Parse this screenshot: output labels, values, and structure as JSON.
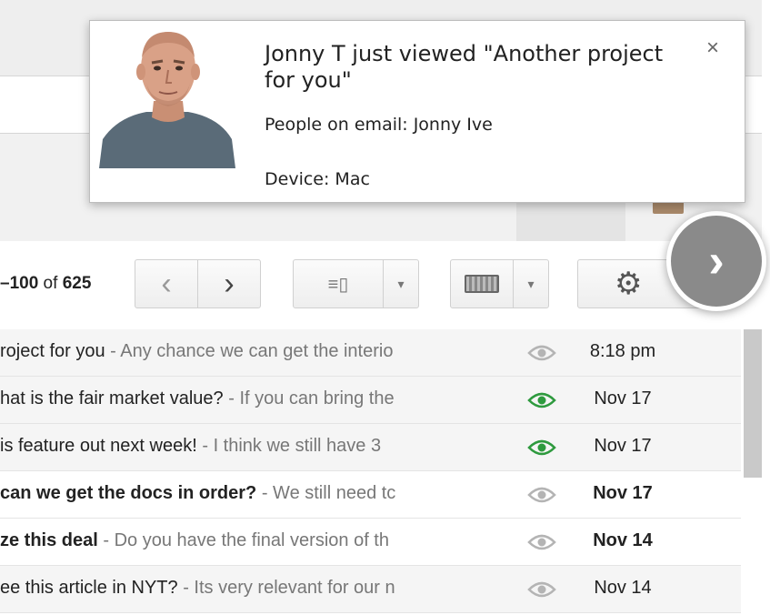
{
  "notification": {
    "title": "Jonny T just viewed \"Another project for you\"",
    "people": "People on email: Jonny Ive",
    "device": "Device: Mac",
    "close_icon": "×"
  },
  "toolbar": {
    "count_range": "–100",
    "count_of": " of ",
    "count_total": "625",
    "prev_icon": "‹",
    "next_icon": "›",
    "split_icon": "≡▯",
    "dropdown_icon": "▾",
    "gear_icon": "⚙",
    "round_next_icon": "›"
  },
  "emails": [
    {
      "subject": "roject for you",
      "snippet": " - Any chance we can get the interio",
      "date": "8:18 pm",
      "eye_color": "#b4b4b4",
      "read": true
    },
    {
      "subject": "hat is the fair market value?",
      "snippet": " - If you can bring the",
      "date": "Nov 17",
      "eye_color": "#2e9a3e",
      "read": true
    },
    {
      "subject": "is feature out next week!",
      "snippet": " - I think we still have 3",
      "date": "Nov 17",
      "eye_color": "#2e9a3e",
      "read": true
    },
    {
      "subject": "can we get the docs in order?",
      "snippet": " - We still need tc",
      "date": "Nov 17",
      "eye_color": "#b4b4b4",
      "read": false
    },
    {
      "subject": "ze this deal",
      "snippet": " - Do you have the final version of th",
      "date": "Nov 14",
      "eye_color": "#b4b4b4",
      "read": false
    },
    {
      "subject": "ee this article in NYT?",
      "snippet": " - Its very relevant for our n",
      "date": "Nov 14",
      "eye_color": "#b4b4b4",
      "read": true
    }
  ]
}
